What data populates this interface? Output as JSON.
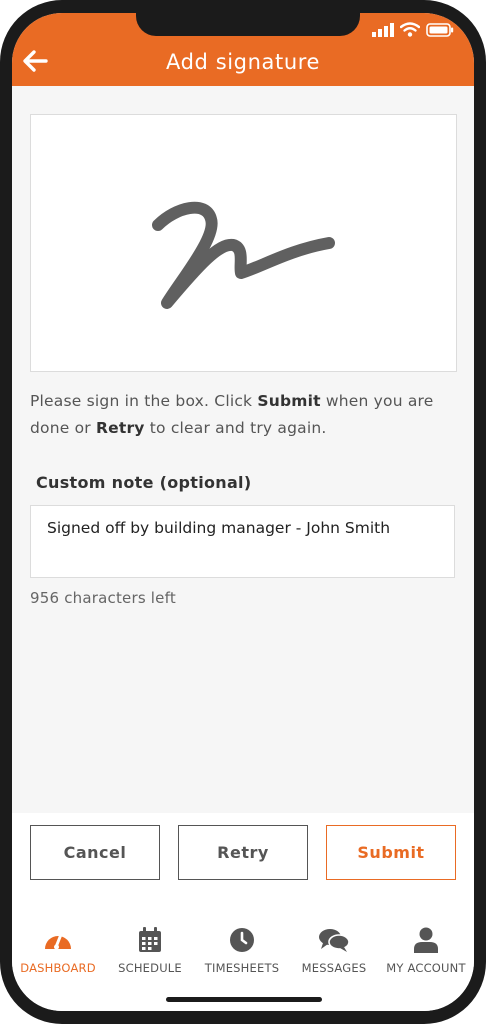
{
  "header": {
    "title": "Add signature",
    "back_icon": "arrow-left-icon",
    "color": "#e96b24"
  },
  "status_bar": {
    "icons": [
      "signal-icon",
      "wifi-icon",
      "battery-icon"
    ]
  },
  "signature": {
    "instructions": {
      "part1": "Please sign in the box. Click ",
      "submit_word": "Submit",
      "part2": " when you are done or ",
      "retry_word": "Retry",
      "part3": " to clear and try again."
    }
  },
  "note": {
    "label": "Custom note (optional)",
    "value": "Signed off by building manager - John Smith",
    "chars_left": "956 characters left"
  },
  "actions": {
    "cancel_label": "Cancel",
    "retry_label": "Retry",
    "submit_label": "Submit"
  },
  "tabs": [
    {
      "label": "DASHBOARD",
      "icon": "dashboard-gauge-icon",
      "active": true
    },
    {
      "label": "SCHEDULE",
      "icon": "calendar-icon",
      "active": false
    },
    {
      "label": "TIMESHEETS",
      "icon": "clock-icon",
      "active": false
    },
    {
      "label": "MESSAGES",
      "icon": "chat-bubbles-icon",
      "active": false
    },
    {
      "label": "MY ACCOUNT",
      "icon": "person-icon",
      "active": false
    }
  ]
}
